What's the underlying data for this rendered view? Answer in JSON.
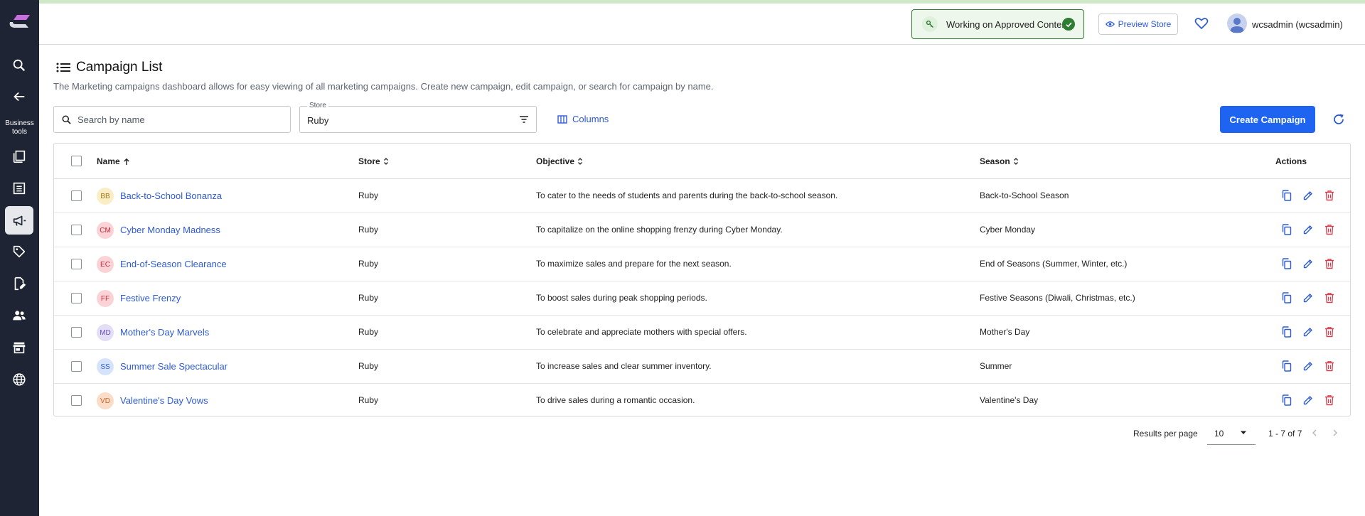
{
  "header": {
    "status_text": "Working on Approved Content",
    "preview_label": "Preview Store",
    "user_name": "wcsadmin (wcsadmin)"
  },
  "sidebar": {
    "section_label": "Business tools",
    "items": [
      {
        "icon": "search-icon"
      },
      {
        "icon": "arrow-left-icon"
      },
      {
        "icon": "catalog-icon"
      },
      {
        "icon": "list-icon"
      },
      {
        "icon": "megaphone-icon",
        "active": true
      },
      {
        "icon": "tag-icon"
      },
      {
        "icon": "edit-document-icon"
      },
      {
        "icon": "people-icon"
      },
      {
        "icon": "store-icon"
      },
      {
        "icon": "globe-icon"
      }
    ]
  },
  "page": {
    "title": "Campaign List",
    "description": "The Marketing campaigns dashboard allows for easy viewing of all marketing campaigns. Create new campaign, edit campaign, or search for campaign by name."
  },
  "toolbar": {
    "search_placeholder": "Search by name",
    "store_label": "Store",
    "store_value": "Ruby",
    "columns_label": "Columns",
    "create_label": "Create Campaign"
  },
  "table": {
    "headers": {
      "name": "Name",
      "store": "Store",
      "objective": "Objective",
      "season": "Season",
      "actions": "Actions"
    },
    "rows": [
      {
        "initials": "BB",
        "name": "Back-to-School Bonanza",
        "store": "Ruby",
        "objective": "To cater to the needs of students and parents during the back-to-school season.",
        "season": "Back-to-School Season",
        "badge_bg": "#fbedc5",
        "badge_fg": "#9a7a1c"
      },
      {
        "initials": "CM",
        "name": "Cyber Monday Madness",
        "store": "Ruby",
        "objective": "To capitalize on the online shopping frenzy during Cyber Monday.",
        "season": "Cyber Monday",
        "badge_bg": "#fbd3d6",
        "badge_fg": "#c52a3a"
      },
      {
        "initials": "EC",
        "name": "End-of-Season Clearance",
        "store": "Ruby",
        "objective": "To maximize sales and prepare for the next season.",
        "season": "End of Seasons (Summer, Winter, etc.)",
        "badge_bg": "#fbd3d6",
        "badge_fg": "#c52a3a"
      },
      {
        "initials": "FF",
        "name": "Festive Frenzy",
        "store": "Ruby",
        "objective": "To boost sales during peak shopping periods.",
        "season": "Festive Seasons (Diwali, Christmas, etc.)",
        "badge_bg": "#fbd3d6",
        "badge_fg": "#c52a3a"
      },
      {
        "initials": "MD",
        "name": "Mother's Day Marvels",
        "store": "Ruby",
        "objective": "To celebrate and appreciate mothers with special offers.",
        "season": "Mother's Day",
        "badge_bg": "#e4ddf6",
        "badge_fg": "#6b4fc1"
      },
      {
        "initials": "SS",
        "name": "Summer Sale Spectacular",
        "store": "Ruby",
        "objective": "To increase sales and clear summer inventory.",
        "season": "Summer",
        "badge_bg": "#d6e4fb",
        "badge_fg": "#2d5bd6"
      },
      {
        "initials": "VD",
        "name": "Valentine's Day Vows",
        "store": "Ruby",
        "objective": "To drive sales during a romantic occasion.",
        "season": "Valentine's Day",
        "badge_bg": "#fbdcc7",
        "badge_fg": "#c9652a"
      }
    ]
  },
  "pagination": {
    "results_label": "Results per page",
    "per_page": "10",
    "range": "1 - 7 of 7"
  },
  "colors": {
    "accent": "#1e64f0",
    "link": "#2d5bd6",
    "delete": "#e03b4a",
    "sidebar": "#1e2433"
  }
}
